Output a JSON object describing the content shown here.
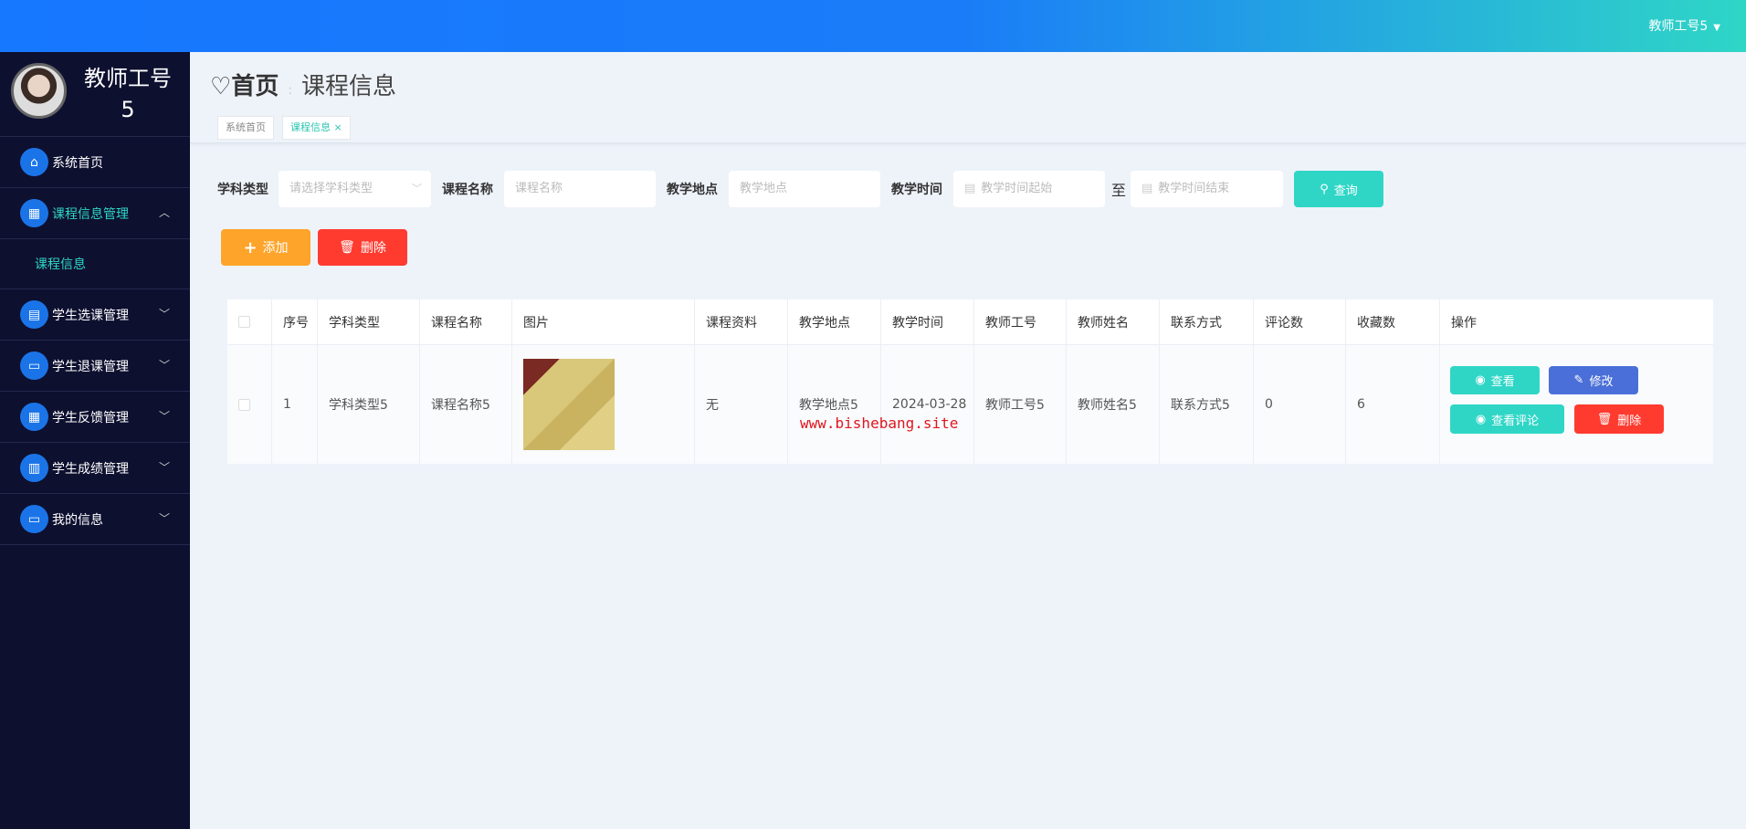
{
  "header": {
    "user": "教师工号5"
  },
  "sidebar": {
    "name_line1": "教师工号",
    "name_line2": "5",
    "items": [
      {
        "label": "系统首页",
        "icon": "home-icon"
      },
      {
        "label": "课程信息管理",
        "icon": "grid-icon",
        "expanded": true
      },
      {
        "label": "学生选课管理",
        "icon": "clipboard-icon"
      },
      {
        "label": "学生退课管理",
        "icon": "monitor-icon"
      },
      {
        "label": "学生反馈管理",
        "icon": "grid-icon"
      },
      {
        "label": "学生成绩管理",
        "icon": "bar-chart-icon"
      },
      {
        "label": "我的信息",
        "icon": "card-icon"
      }
    ],
    "sub": "课程信息"
  },
  "breadcrumb": {
    "home": "首页",
    "current": "课程信息"
  },
  "tags": [
    {
      "label": "系统首页"
    },
    {
      "label": "课程信息"
    }
  ],
  "search": {
    "labels": [
      "学科类型",
      "课程名称",
      "教学地点",
      "教学时间"
    ],
    "subject_placeholder": "请选择学科类型",
    "name_placeholder": "课程名称",
    "place_placeholder": "教学地点",
    "time_start_placeholder": "教学时间起始",
    "to": "至",
    "time_end_placeholder": "教学时间结束",
    "query": "查询"
  },
  "actions": {
    "add": "添加",
    "delete": "删除"
  },
  "table": {
    "columns": [
      "序号",
      "学科类型",
      "课程名称",
      "图片",
      "课程资料",
      "教学地点",
      "教学时间",
      "教师工号",
      "教师姓名",
      "联系方式",
      "评论数",
      "收藏数",
      "操作"
    ],
    "rows": [
      {
        "cells": [
          "1",
          "学科类型5",
          "课程名称5",
          "",
          "无",
          "教学地点5",
          "2024-03-28",
          "教师工号5",
          "教师姓名5",
          "联系方式5",
          "0",
          "6"
        ],
        "ops": {
          "view": "查看",
          "edit": "修改",
          "comments": "查看评论",
          "delete": "删除"
        }
      }
    ]
  },
  "watermark": "www.bishebang.site",
  "colors": {
    "accent": "#2fd6c6",
    "primary": "#1677ff",
    "warning": "#ffa42a",
    "danger": "#ff3b30",
    "edit": "#4a6fd8",
    "sidebar": "#0e1030"
  }
}
